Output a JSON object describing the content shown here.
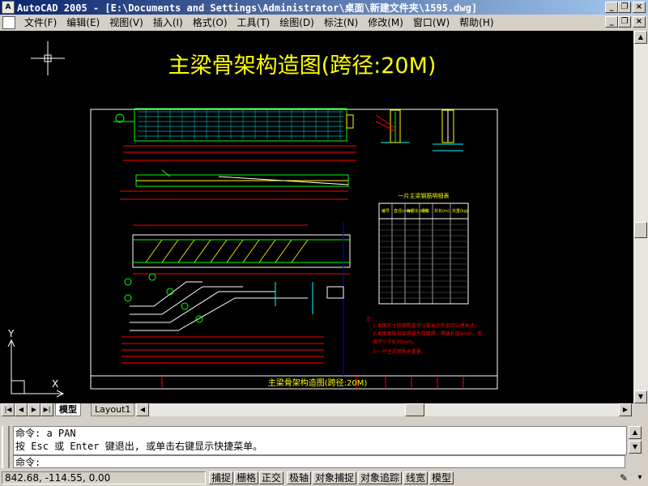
{
  "window": {
    "title": "AutoCAD 2005 - [E:\\Documents and Settings\\Administrator\\桌面\\新建文件夹\\1595.dwg]",
    "icon_label": "A",
    "buttons": [
      "minimize",
      "restore",
      "close"
    ]
  },
  "menu": {
    "items": [
      "文件(F)",
      "编辑(E)",
      "视图(V)",
      "插入(I)",
      "格式(O)",
      "工具(T)",
      "绘图(D)",
      "标注(N)",
      "修改(M)",
      "窗口(W)",
      "帮助(H)"
    ]
  },
  "drawing": {
    "title": "主梁骨架构造图(跨径:20M)",
    "table_title": "一片主梁钢筋明细表",
    "table_headers": [
      "编号",
      "直径(mm)",
      "每根长(cm)",
      "根数",
      "共长(m)",
      "共重(kg)"
    ],
    "notes_title": "注：",
    "notes": [
      "1.本图尺寸除钢筋直径以毫米计外余均以厘米计。",
      "2.本图钢筋骨架焊缝为双面焊，焊缝长度4mm，厚",
      "  度不小于8.00mm。",
      "3.一片主梁钢筋总重量。"
    ],
    "title_block": "主梁骨架构造图(跨径:20M)"
  },
  "tabs": {
    "model": "模型",
    "layout": "Layout1"
  },
  "command": {
    "history": [
      "命令: a PAN",
      "按 Esc 或 Enter 键退出, 或单击右键显示快捷菜单。"
    ],
    "prompt": "命令:"
  },
  "status": {
    "coords": "842.68, -114.55, 0.00",
    "toggles": [
      "捕捉",
      "栅格",
      "正交",
      "极轴",
      "对象捕捉",
      "对象追踪",
      "线宽",
      "模型"
    ]
  },
  "ucs": {
    "x": "X",
    "y": "Y"
  },
  "colors": {
    "canvas": "#000000",
    "title_yellow": "#ffff00",
    "frame_white": "#ffffff",
    "red": "#ff0000",
    "green": "#00ff00",
    "cyan": "#00ffff"
  }
}
